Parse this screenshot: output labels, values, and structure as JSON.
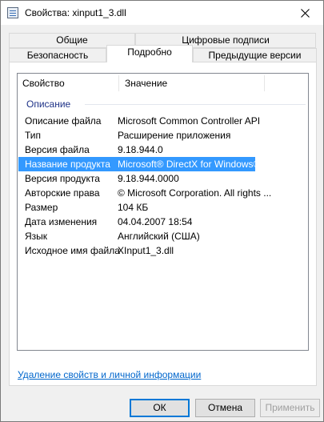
{
  "window": {
    "title": "Свойства: xinput1_3.dll"
  },
  "tabs_row1": [
    {
      "label": "Общие"
    },
    {
      "label": "Цифровые подписи"
    }
  ],
  "tabs_row2": [
    {
      "label": "Безопасность"
    },
    {
      "label": "Подробно"
    },
    {
      "label": "Предыдущие версии"
    }
  ],
  "list": {
    "col_property": "Свойство",
    "col_value": "Значение",
    "group": "Описание",
    "rows": [
      {
        "key": "Описание файла",
        "value": "Microsoft Common Controller API"
      },
      {
        "key": "Тип",
        "value": "Расширение приложения"
      },
      {
        "key": "Версия файла",
        "value": "9.18.944.0"
      },
      {
        "key": "Название продукта",
        "value": "Microsoft® DirectX for Windows®"
      },
      {
        "key": "Версия продукта",
        "value": "9.18.944.0000"
      },
      {
        "key": "Авторские права",
        "value": "© Microsoft Corporation. All rights ..."
      },
      {
        "key": "Размер",
        "value": "104 КБ"
      },
      {
        "key": "Дата изменения",
        "value": "04.04.2007 18:54"
      },
      {
        "key": "Язык",
        "value": "Английский (США)"
      },
      {
        "key": "Исходное имя файла",
        "value": "XInput1_3.dll"
      }
    ],
    "selected_index": 3
  },
  "link_text": "Удаление свойств и личной информации",
  "buttons": {
    "ok": "ОК",
    "cancel": "Отмена",
    "apply": "Применить"
  },
  "colors": {
    "selection": "#3399ff",
    "group_text": "#1e3287",
    "link": "#0066cc"
  }
}
